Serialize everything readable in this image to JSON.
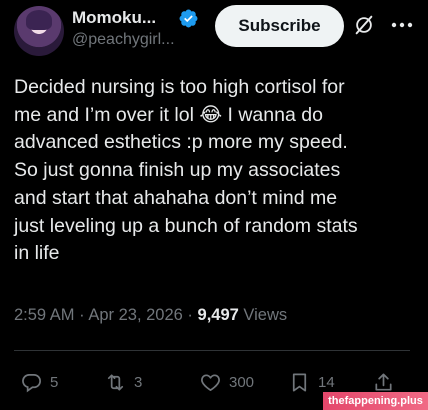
{
  "header": {
    "display_name": "Momoku...",
    "handle": "@peachygirl...",
    "subscribe_label": "Subscribe",
    "verified_icon": "verified-badge-icon",
    "grok_icon": "grok-icon",
    "more_icon": "more-icon"
  },
  "tweet": {
    "lines": [
      "Decided nursing is too high cortisol for",
      "me and I’m over it lol 😂 I wanna do",
      "advanced esthetics :p more my speed.",
      "So just gonna finish up my associates",
      "and start that ahahaha don’t mind me",
      "just leveling up a bunch of random stats",
      "in life"
    ]
  },
  "meta": {
    "time": "2:59 AM",
    "dot1": "·",
    "date": "Apr 23, 2026",
    "dot2": "·",
    "views_count": "9,497",
    "views_label": "Views"
  },
  "actions": {
    "replies": "5",
    "reposts": "3",
    "likes": "300",
    "bookmarks": "14"
  },
  "watermark": "thefappening.plus",
  "colors": {
    "background": "#000000",
    "text": "#e7e9ea",
    "muted": "#71767b",
    "verified": "#1d9bf0",
    "watermark": "#e4476b"
  }
}
